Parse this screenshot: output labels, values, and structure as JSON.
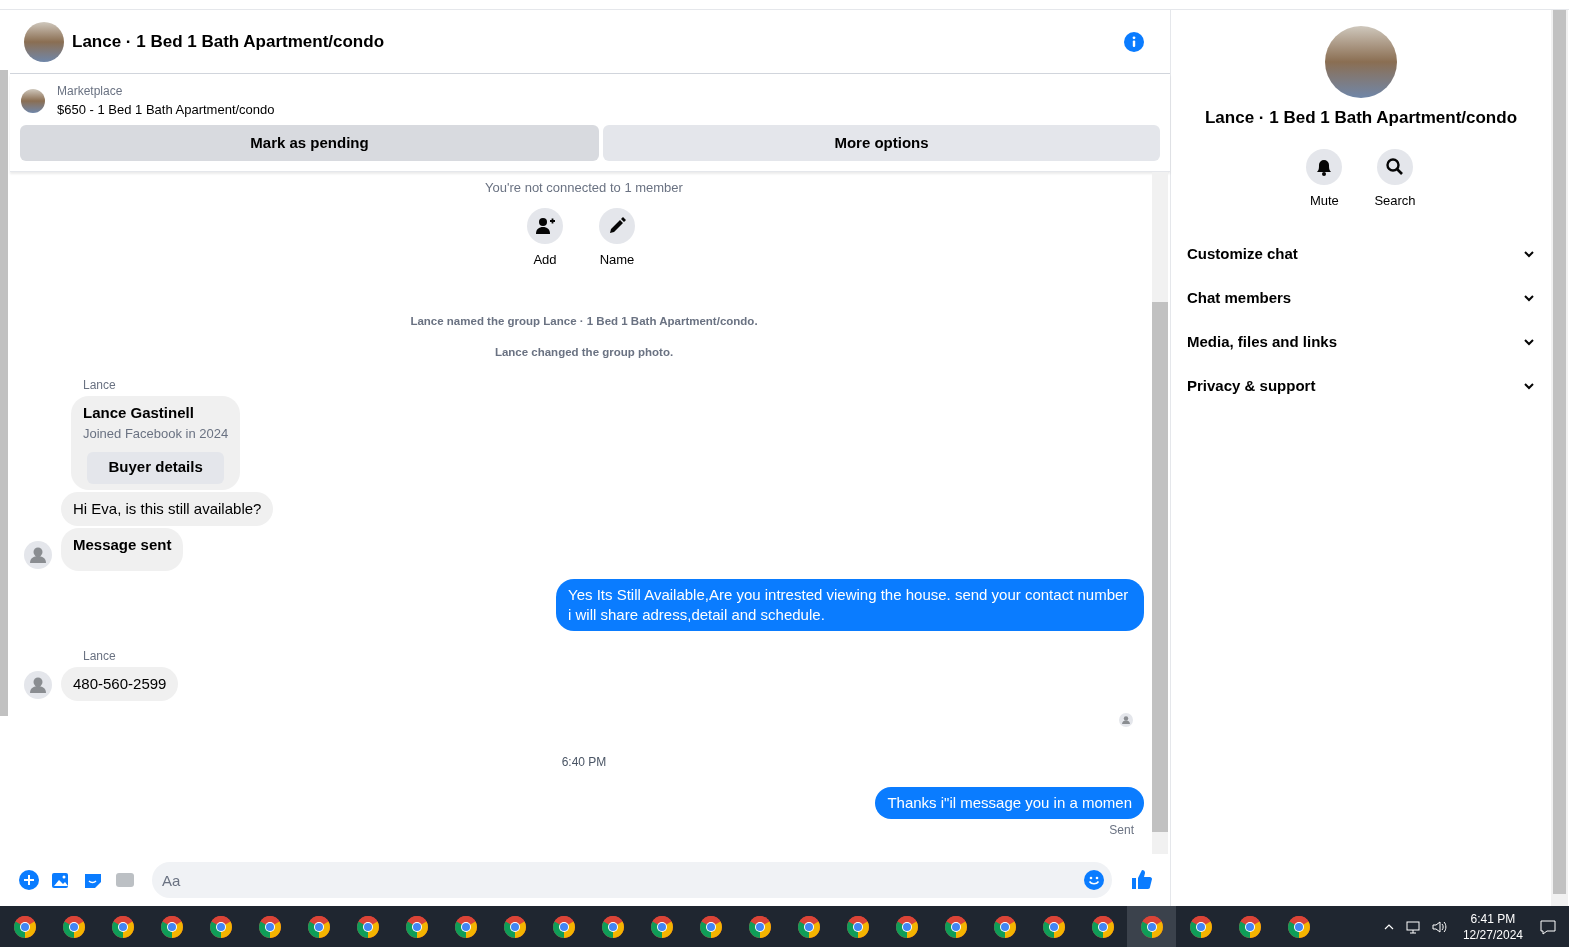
{
  "header": {
    "title": "Lance · 1 Bed 1 Bath Apartment/condo"
  },
  "listing": {
    "source": "Marketplace",
    "title": "$650 - 1 Bed 1 Bath Apartment/condo",
    "buttons": [
      "Mark as pending",
      "More options"
    ]
  },
  "conversation": {
    "notice": "You're not connected to 1 member",
    "actions": [
      {
        "kind": "add",
        "label": "Add"
      },
      {
        "kind": "name",
        "label": "Name"
      }
    ],
    "items": [
      {
        "kind": "event",
        "text": "Lance named the group Lance · 1 Bed 1 Bath Apartment/condo."
      },
      {
        "kind": "event",
        "text": "Lance changed the group photo."
      },
      {
        "kind": "card",
        "sender": "Lance",
        "name": "Lance Gastinell",
        "detail": "Joined Facebook in 2024",
        "button": "Buyer details"
      },
      {
        "kind": "incoming",
        "text": "Hi Eva, is this still available?",
        "avatar": false
      },
      {
        "kind": "incoming",
        "text": "Message sent",
        "avatar": true,
        "bold": true
      },
      {
        "kind": "outgoing",
        "text": "Yes Its Still Available,Are you intrested viewing the house. send your contact number i will share adress,detail and schedule."
      },
      {
        "kind": "incoming",
        "sender": "Lance",
        "text": "480-560-2599",
        "avatar": true
      },
      {
        "kind": "seen"
      },
      {
        "kind": "time",
        "text": "6:40 PM"
      },
      {
        "kind": "outgoing",
        "text": "Thanks i\"il message you in a momen",
        "status": "Sent"
      }
    ]
  },
  "composer": {
    "placeholder": "Aa"
  },
  "details": {
    "title": "Lance · 1 Bed 1 Bath Apartment/condo",
    "actions": [
      {
        "kind": "mute",
        "label": "Mute"
      },
      {
        "kind": "search",
        "label": "Search"
      }
    ],
    "sections": [
      {
        "label": "Customize chat",
        "expanded": false
      },
      {
        "label": "Chat members",
        "expanded": false
      },
      {
        "label": "Media, files and links",
        "expanded": false
      },
      {
        "label": "Privacy & support",
        "expanded": false
      }
    ]
  },
  "taskbar": {
    "apps": [
      {
        "selected": false
      },
      {
        "selected": false
      },
      {
        "selected": false
      },
      {
        "selected": false
      },
      {
        "selected": false
      },
      {
        "selected": false
      },
      {
        "selected": false
      },
      {
        "selected": false
      },
      {
        "selected": false
      },
      {
        "selected": false
      },
      {
        "selected": false
      },
      {
        "selected": false
      },
      {
        "selected": false
      },
      {
        "selected": false
      },
      {
        "selected": false
      },
      {
        "selected": false
      },
      {
        "selected": false
      },
      {
        "selected": false
      },
      {
        "selected": false
      },
      {
        "selected": false
      },
      {
        "selected": false
      },
      {
        "selected": false
      },
      {
        "selected": false
      },
      {
        "selected": true
      },
      {
        "selected": false
      },
      {
        "selected": false
      },
      {
        "selected": false
      }
    ],
    "time": "6:41 PM",
    "date": "12/27/2024"
  }
}
